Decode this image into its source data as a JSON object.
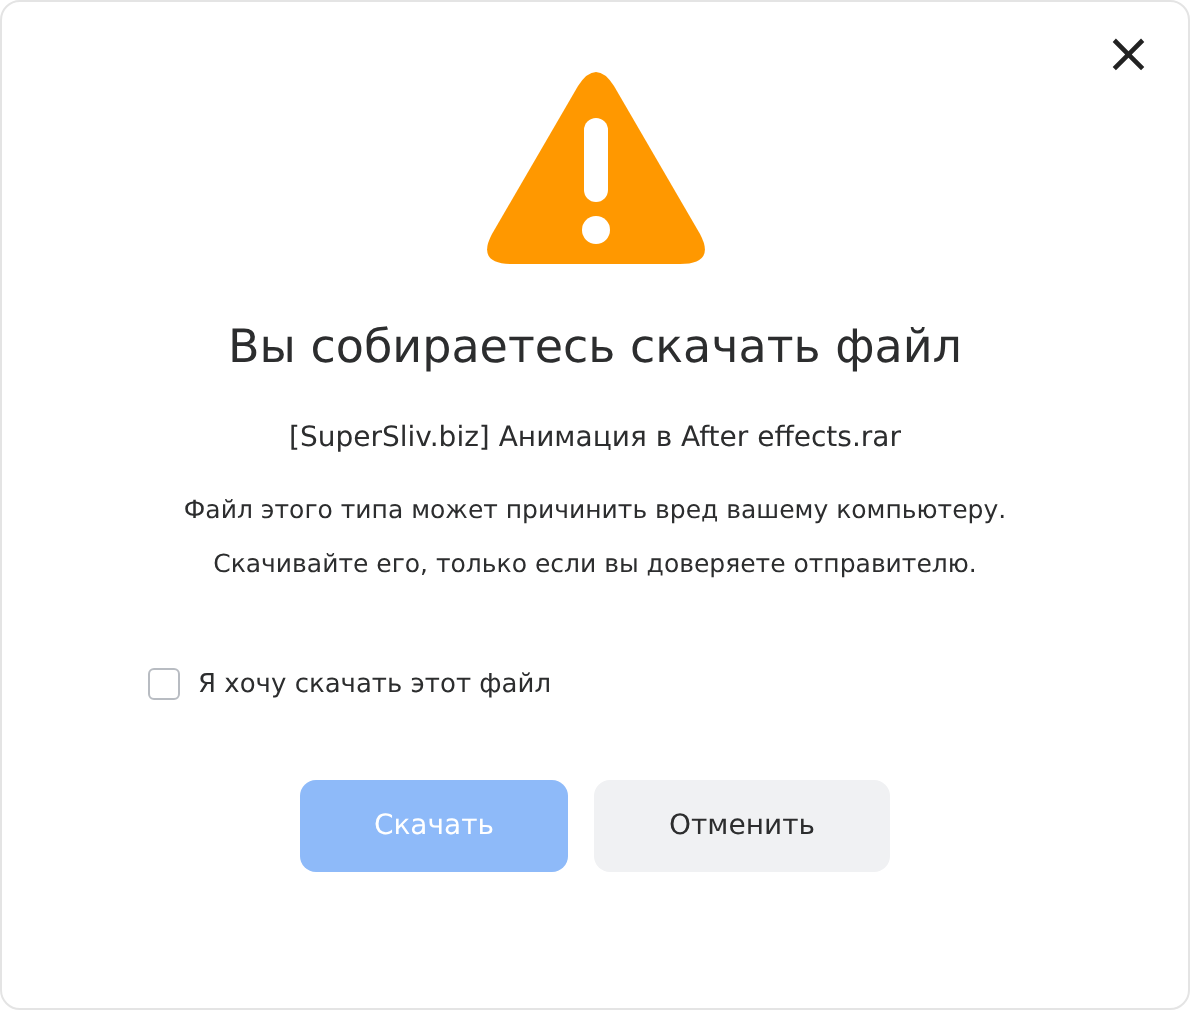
{
  "dialog": {
    "close": "×",
    "title": "Вы собираетесь скачать файл",
    "filename": "[SuperSliv.biz] Анимация в After effects.rar",
    "warning_lines": [
      "Файл этого типа может причинить вред вашему компьютеру.",
      "Скачивайте его, только если вы доверяете отправителю."
    ],
    "confirm": {
      "label": "Я хочу скачать этот файл",
      "checked": false
    },
    "buttons": [
      {
        "kind": "primary",
        "label": "Скачать",
        "disabled": true
      },
      {
        "kind": "secondary",
        "label": "Отменить",
        "disabled": false
      }
    ]
  }
}
